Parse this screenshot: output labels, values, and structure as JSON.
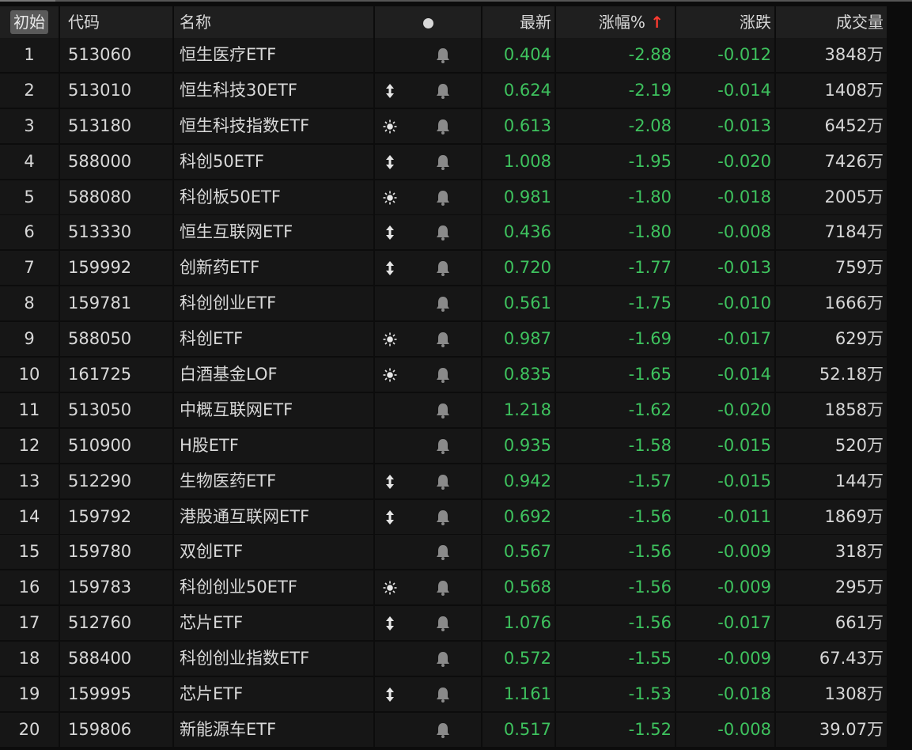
{
  "header": {
    "idx_label": "初始",
    "code_label": "代码",
    "name_label": "名称",
    "price_label": "最新",
    "pct_label": "涨幅%",
    "pct_sort_arrow": "↑",
    "chg_label": "涨跌",
    "vol_label": "成交量"
  },
  "colors": {
    "down": "#3ec25e",
    "text": "#d8d8d8",
    "sort_arrow": "#ff3b30"
  },
  "rows": [
    {
      "idx": "1",
      "code": "513060",
      "name": "恒生医疗ETF",
      "flag": "",
      "price": "0.404",
      "pct": "-2.88",
      "chg": "-0.012",
      "vol": "3848万"
    },
    {
      "idx": "2",
      "code": "513010",
      "name": "恒生科技30ETF",
      "flag": "updown",
      "price": "0.624",
      "pct": "-2.19",
      "chg": "-0.014",
      "vol": "1408万"
    },
    {
      "idx": "3",
      "code": "513180",
      "name": "恒生科技指数ETF",
      "flag": "sun",
      "price": "0.613",
      "pct": "-2.08",
      "chg": "-0.013",
      "vol": "6452万"
    },
    {
      "idx": "4",
      "code": "588000",
      "name": "科创50ETF",
      "flag": "updown",
      "price": "1.008",
      "pct": "-1.95",
      "chg": "-0.020",
      "vol": "7426万"
    },
    {
      "idx": "5",
      "code": "588080",
      "name": "科创板50ETF",
      "flag": "sun",
      "price": "0.981",
      "pct": "-1.80",
      "chg": "-0.018",
      "vol": "2005万"
    },
    {
      "idx": "6",
      "code": "513330",
      "name": "恒生互联网ETF",
      "flag": "updown",
      "price": "0.436",
      "pct": "-1.80",
      "chg": "-0.008",
      "vol": "7184万"
    },
    {
      "idx": "7",
      "code": "159992",
      "name": "创新药ETF",
      "flag": "updown",
      "price": "0.720",
      "pct": "-1.77",
      "chg": "-0.013",
      "vol": "759万"
    },
    {
      "idx": "8",
      "code": "159781",
      "name": "科创创业ETF",
      "flag": "",
      "price": "0.561",
      "pct": "-1.75",
      "chg": "-0.010",
      "vol": "1666万"
    },
    {
      "idx": "9",
      "code": "588050",
      "name": "科创ETF",
      "flag": "sun",
      "price": "0.987",
      "pct": "-1.69",
      "chg": "-0.017",
      "vol": "629万"
    },
    {
      "idx": "10",
      "code": "161725",
      "name": "白酒基金LOF",
      "flag": "sun",
      "price": "0.835",
      "pct": "-1.65",
      "chg": "-0.014",
      "vol": "52.18万"
    },
    {
      "idx": "11",
      "code": "513050",
      "name": "中概互联网ETF",
      "flag": "",
      "price": "1.218",
      "pct": "-1.62",
      "chg": "-0.020",
      "vol": "1858万"
    },
    {
      "idx": "12",
      "code": "510900",
      "name": "H股ETF",
      "flag": "",
      "price": "0.935",
      "pct": "-1.58",
      "chg": "-0.015",
      "vol": "520万"
    },
    {
      "idx": "13",
      "code": "512290",
      "name": "生物医药ETF",
      "flag": "updown",
      "price": "0.942",
      "pct": "-1.57",
      "chg": "-0.015",
      "vol": "144万"
    },
    {
      "idx": "14",
      "code": "159792",
      "name": "港股通互联网ETF",
      "flag": "updown",
      "price": "0.692",
      "pct": "-1.56",
      "chg": "-0.011",
      "vol": "1869万"
    },
    {
      "idx": "15",
      "code": "159780",
      "name": "双创ETF",
      "flag": "",
      "price": "0.567",
      "pct": "-1.56",
      "chg": "-0.009",
      "vol": "318万"
    },
    {
      "idx": "16",
      "code": "159783",
      "name": "科创创业50ETF",
      "flag": "sun",
      "price": "0.568",
      "pct": "-1.56",
      "chg": "-0.009",
      "vol": "295万"
    },
    {
      "idx": "17",
      "code": "512760",
      "name": "芯片ETF",
      "flag": "updown",
      "price": "1.076",
      "pct": "-1.56",
      "chg": "-0.017",
      "vol": "661万"
    },
    {
      "idx": "18",
      "code": "588400",
      "name": "科创创业指数ETF",
      "flag": "",
      "price": "0.572",
      "pct": "-1.55",
      "chg": "-0.009",
      "vol": "67.43万"
    },
    {
      "idx": "19",
      "code": "159995",
      "name": "芯片ETF",
      "flag": "updown",
      "price": "1.161",
      "pct": "-1.53",
      "chg": "-0.018",
      "vol": "1308万"
    },
    {
      "idx": "20",
      "code": "159806",
      "name": "新能源车ETF",
      "flag": "",
      "price": "0.517",
      "pct": "-1.52",
      "chg": "-0.008",
      "vol": "39.07万"
    }
  ]
}
